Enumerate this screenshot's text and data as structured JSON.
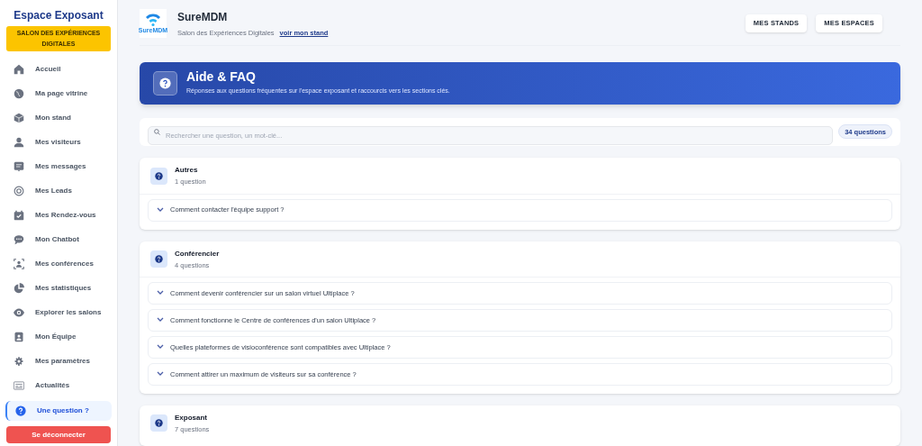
{
  "sidebar": {
    "title": "Espace Exposant",
    "event_badge": "SALON DES EXPÉRIENCES DIGITALES",
    "items": [
      {
        "label": "Accueil",
        "selected": false
      },
      {
        "label": "Ma page vitrine",
        "selected": false
      },
      {
        "label": "Mon stand",
        "selected": false
      },
      {
        "label": "Mes visiteurs",
        "selected": false
      },
      {
        "label": "Mes messages",
        "selected": false
      },
      {
        "label": "Mes Leads",
        "selected": false
      },
      {
        "label": "Mes Rendez-vous",
        "selected": false
      },
      {
        "label": "Mon Chatbot",
        "selected": false
      },
      {
        "label": "Mes conférences",
        "selected": false
      },
      {
        "label": "Mes statistiques",
        "selected": false
      },
      {
        "label": "Explorer les salons",
        "selected": false
      },
      {
        "label": "Mon Équipe",
        "selected": false
      },
      {
        "label": "Mes paramètres",
        "selected": false
      },
      {
        "label": "Actualités",
        "selected": false
      },
      {
        "label": "Une question ?",
        "selected": true
      }
    ],
    "logout_button": "Se déconnecter"
  },
  "header": {
    "logo_text": "SureMDM",
    "company": "SureMDM",
    "event": "Salon des Expériences Digitales",
    "stand_link": "voir mon stand",
    "buttons": [
      "MES STANDS",
      "MES ESPACES"
    ]
  },
  "banner": {
    "title": "Aide & FAQ",
    "subtitle": "Réponses aux questions fréquentes sur l'espace exposant et raccourcis vers les sections clés."
  },
  "search": {
    "placeholder": "Rechercher une question, un mot-clé...",
    "count": "34 questions"
  },
  "sections": [
    {
      "title": "Autres",
      "count": "1 question",
      "questions": [
        "Comment contacter l'équipe support ?"
      ]
    },
    {
      "title": "Conférencier",
      "count": "4 questions",
      "questions": [
        "Comment devenir conférencier sur un salon virtuel Ultiplace ?",
        "Comment fonctionne le Centre de conférences d'un salon Ultiplace ?",
        "Quelles plateformes de visioconférence sont compatibles avec Ultiplace ?",
        "Comment attirer un maximum de visiteurs sur sa conférence ?"
      ]
    },
    {
      "title": "Exposant",
      "count": "7 questions"
    }
  ]
}
